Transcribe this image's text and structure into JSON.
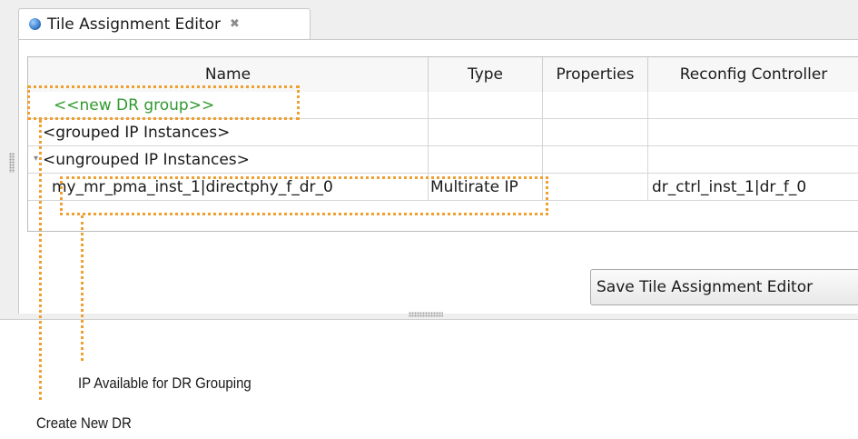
{
  "tab": {
    "title": "Tile Assignment Editor",
    "close_glyph": "✖",
    "icon": "blue-sphere-icon"
  },
  "table": {
    "columns": [
      "Name",
      "Type",
      "Properties",
      "Reconfig Controller"
    ],
    "rows": [
      {
        "name": "<<new DR group>>",
        "type": "",
        "properties": "",
        "controller": ""
      },
      {
        "name": "<grouped IP Instances>",
        "type": "",
        "properties": "",
        "controller": ""
      },
      {
        "name": "<ungrouped IP Instances>",
        "type": "",
        "properties": "",
        "controller": ""
      },
      {
        "name": "my_mr_pma_inst_1|directphy_f_dr_0",
        "type": "Multirate IP",
        "properties": "",
        "controller": "dr_ctrl_inst_1|dr_f_0"
      }
    ]
  },
  "save_button": {
    "label": "Save Tile Assignment Editor"
  },
  "annotations": {
    "ip_available": "IP Available for DR Grouping",
    "create_new_dr": "Create New DR"
  },
  "colors": {
    "annotation": "#f0a030",
    "new_group_text": "#2f9a2f",
    "tab_icon": "#2f7fd0"
  }
}
